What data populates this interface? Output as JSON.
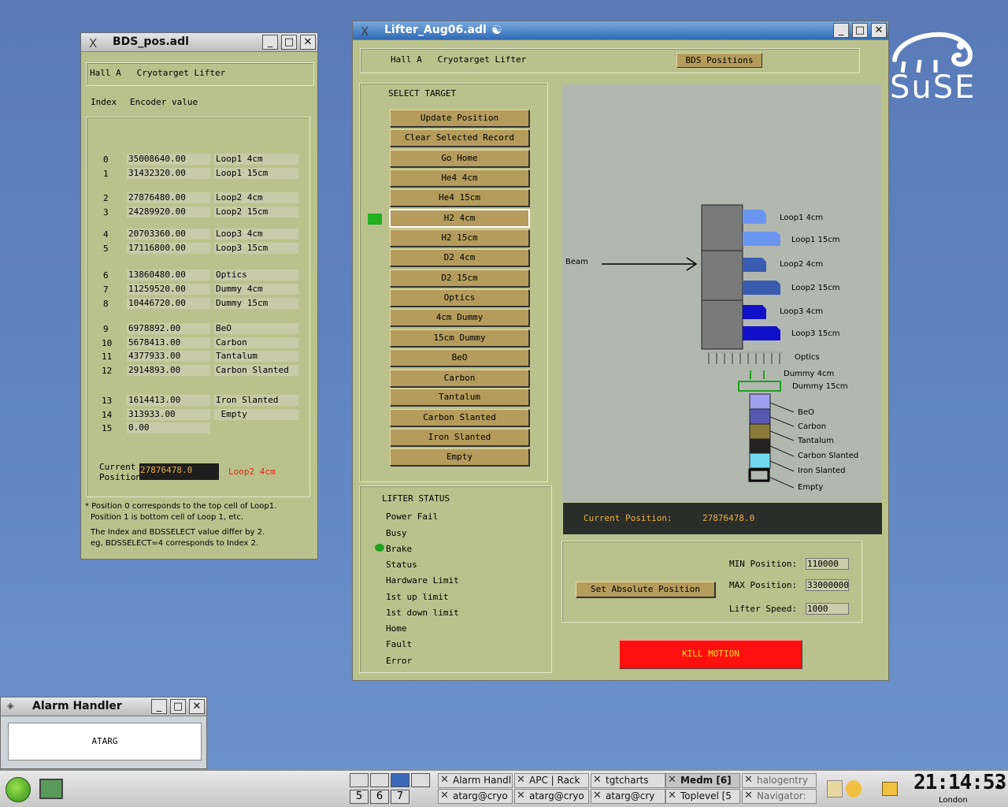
{
  "desktop": {
    "logo_text": "SuSE"
  },
  "bds": {
    "title": "BDS_pos.adl",
    "header": "Hall A   Cryotarget Lifter",
    "col_index": "Index",
    "col_encoder": "Encoder value",
    "rows": [
      {
        "index": "0",
        "encoder": "35008640.00",
        "name": "Loop1 4cm"
      },
      {
        "index": "1",
        "encoder": "31432320.00",
        "name": "Loop1 15cm"
      },
      {
        "index": "2",
        "encoder": "27876480.00",
        "name": "Loop2 4cm"
      },
      {
        "index": "3",
        "encoder": "24289920.00",
        "name": "Loop2 15cm"
      },
      {
        "index": "4",
        "encoder": "20703360.00",
        "name": "Loop3 4cm"
      },
      {
        "index": "5",
        "encoder": "17116800.00",
        "name": "Loop3 15cm"
      },
      {
        "index": "6",
        "encoder": "13860480.00",
        "name": "Optics"
      },
      {
        "index": "7",
        "encoder": "11259520.00",
        "name": "Dummy 4cm"
      },
      {
        "index": "8",
        "encoder": "10446720.00",
        "name": "Dummy 15cm"
      },
      {
        "index": "9",
        "encoder": "6978892.00",
        "name": "BeO"
      },
      {
        "index": "10",
        "encoder": "5678413.00",
        "name": "Carbon"
      },
      {
        "index": "11",
        "encoder": "4377933.00",
        "name": "Tantalum"
      },
      {
        "index": "12",
        "encoder": "2914893.00",
        "name": "Carbon Slanted"
      },
      {
        "index": "13",
        "encoder": "1614413.00",
        "name": "Iron Slanted"
      },
      {
        "index": "14",
        "encoder": "313933.00",
        "name": " Empty"
      },
      {
        "index": "15",
        "encoder": "0.00",
        "name": ""
      }
    ],
    "current_label_1": "Current",
    "current_label_2": "Position",
    "current_value": "27876478.0",
    "current_name": "Loop2 4cm",
    "note1": "* Position 0 corresponds to the top cell of Loop1.",
    "note2": "Position 1 is bottom cell of Loop 1, etc.",
    "note3": "The Index and BDSSELECT value differ by 2.",
    "note4": "eg, BDSSELECT=4 corresponds to Index 2."
  },
  "lifter": {
    "title": "Lifter_Aug06.adl",
    "header": "Hall A   Cryotarget Lifter",
    "bds_button": "BDS Positions",
    "select_title": "SELECT TARGET",
    "targets": [
      "Update Position",
      "Clear Selected Record",
      "Go Home",
      "He4 4cm",
      "He4 15cm",
      "H2 4cm",
      "H2 15cm",
      "D2 4cm",
      "D2 15cm",
      "Optics",
      "4cm Dummy",
      "15cm Dummy",
      "BeO",
      "Carbon",
      "Tantalum",
      "Carbon Slanted",
      "Iron Slanted",
      "Empty"
    ],
    "selected_index": 5,
    "status_title": "LIFTER STATUS",
    "status_items": [
      "Power Fail",
      "Busy",
      "Brake",
      "Status",
      "Hardware Limit",
      "1st up limit",
      "1st down limit",
      "Home",
      "Fault",
      "Error"
    ],
    "status_active_index": 2,
    "diagram": {
      "beam": "Beam",
      "loops": [
        "Loop1 4cm",
        "Loop1 15cm",
        "Loop2 4cm",
        "Loop2 15cm",
        "Loop3 4cm",
        "Loop3 15cm"
      ],
      "optics": "Optics",
      "dummy4": "Dummy 4cm",
      "dummy15": "Dummy 15cm",
      "solids": [
        "BeO",
        "Carbon",
        "Tantalum",
        "Carbon Slanted",
        "Iron Slanted",
        "Empty"
      ]
    },
    "current_label": "Current Position:",
    "current_value": "27876478.0",
    "set_button": "Set Absolute Position",
    "min_label": "MIN Position:",
    "min_value": "110000",
    "max_label": "MAX Position:",
    "max_value": "33000000",
    "speed_label": "Lifter Speed:",
    "speed_value": "1000",
    "kill_button": "KILL MOTION"
  },
  "alarm": {
    "title": "Alarm Handler",
    "label": "ATARG"
  },
  "taskbar": {
    "workspaces": [
      "5",
      "6",
      "7"
    ],
    "tasks": [
      {
        "label": "Alarm Handl"
      },
      {
        "label": "APC | Rack"
      },
      {
        "label": "tgtcharts"
      },
      {
        "label": "Medm [6]"
      },
      {
        "label": "halogentry"
      },
      {
        "label": "atarg@cryo"
      },
      {
        "label": "atarg@cryo"
      },
      {
        "label": "atarg@cry"
      },
      {
        "label": "Toplevel [5"
      },
      {
        "label": "Navigator: "
      }
    ],
    "clock": "21:14:53",
    "clock_city": "London"
  }
}
